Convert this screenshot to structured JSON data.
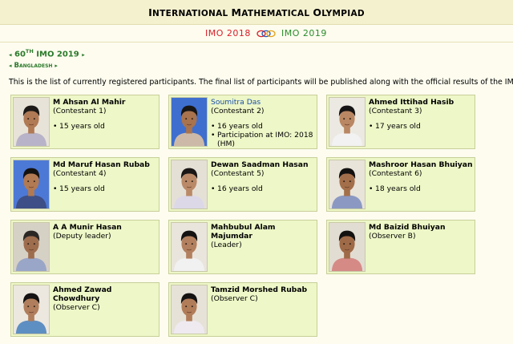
{
  "header": {
    "title_first": "I",
    "title_rest": "NTERNATIONAL ",
    "title_m": "M",
    "title_rest2": "ATHEMATICAL ",
    "title_o": "O",
    "title_rest3": "LYMPIAD"
  },
  "year_nav": {
    "prev": "IMO 2018",
    "next": "IMO 2019"
  },
  "breadcrumb": {
    "imo_prefix": "60",
    "imo_sup": "TH",
    "imo_suffix": " IMO 2019",
    "country": "Bangladesh"
  },
  "notice": "This is the list of currently registered participants. The final list of participants will be published along with the official results of the IMO.",
  "participants": [
    {
      "name": "M Ahsan Al Mahir",
      "role": "(Contestant 1)",
      "facts": [
        "15 years old"
      ],
      "linked": false
    },
    {
      "name": "Soumitra Das",
      "role": "(Contestant 2)",
      "facts": [
        "16 years old",
        "Participation at IMO: 2018 (HM)"
      ],
      "linked": true
    },
    {
      "name": "Ahmed Ittihad Hasib",
      "role": "(Contestant 3)",
      "facts": [
        "17 years old"
      ],
      "linked": false
    },
    {
      "name": "Md Maruf Hasan Rubab",
      "role": "(Contestant 4)",
      "facts": [
        "15 years old"
      ],
      "linked": false
    },
    {
      "name": "Dewan Saadman Hasan",
      "role": "(Contestant 5)",
      "facts": [
        "16 years old"
      ],
      "linked": false
    },
    {
      "name": "Mashroor Hasan Bhuiyan",
      "role": "(Contestant 6)",
      "facts": [
        "18 years old"
      ],
      "linked": false
    },
    {
      "name": "A A Munir Hasan",
      "role": "(Deputy leader)",
      "facts": [],
      "linked": false
    },
    {
      "name": "Mahbubul Alam Majumdar",
      "role": "(Leader)",
      "facts": [],
      "linked": false
    },
    {
      "name": "Md Baizid Bhuiyan",
      "role": "(Observer B)",
      "facts": [],
      "linked": false
    },
    {
      "name": "Ahmed Zawad Chowdhury",
      "role": "(Observer C)",
      "facts": [],
      "linked": false
    },
    {
      "name": "Tamzid Morshed Rubab",
      "role": "(Observer C)",
      "facts": [],
      "linked": false
    }
  ],
  "colors": {
    "background": "#fdfcef",
    "card": "#edf7c7",
    "green_text": "#2b7a2b",
    "prev_year": "#d7202a",
    "next_year": "#2c8c2c",
    "link": "#1b4fa8"
  }
}
